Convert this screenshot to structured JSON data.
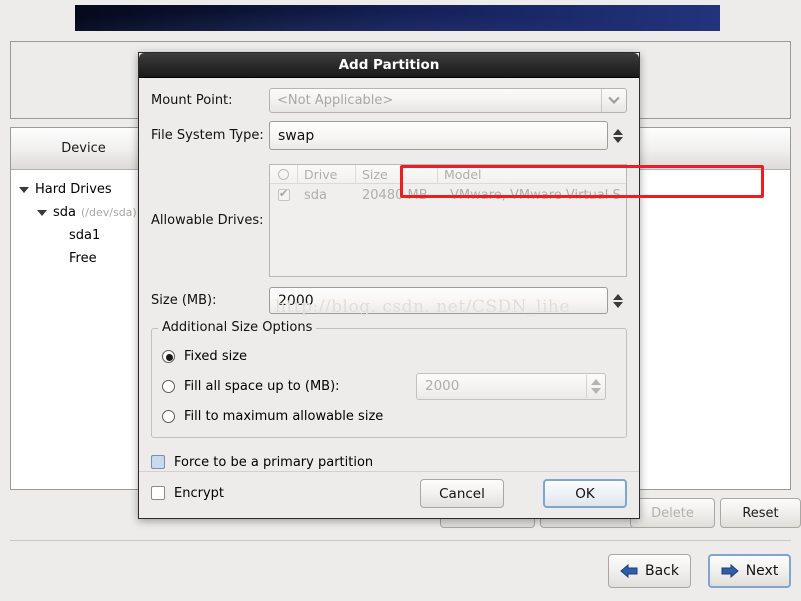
{
  "background_window": {
    "banner": {
      "name": "installer-banner"
    },
    "device_tree": {
      "columns": [
        "Device"
      ],
      "rows": [
        {
          "label": "Hard Drives",
          "sub": "",
          "indent": 0,
          "expander": true
        },
        {
          "label": "sda",
          "sub": "(/dev/sda)",
          "indent": 1,
          "expander": true
        },
        {
          "label": "sda1",
          "sub": "",
          "indent": 2,
          "expander": false
        },
        {
          "label": "Free",
          "sub": "",
          "indent": 2,
          "expander": false
        }
      ]
    },
    "action_buttons": [
      {
        "label": "",
        "disabled": false
      },
      {
        "label": "",
        "disabled": false
      },
      {
        "label": "Delete",
        "disabled": true
      },
      {
        "label": "Reset",
        "disabled": false
      }
    ],
    "nav_buttons": [
      {
        "label": "Back",
        "icon": "arrow-left-icon",
        "focused": false
      },
      {
        "label": "Next",
        "icon": "arrow-right-icon",
        "focused": true
      }
    ]
  },
  "dialog": {
    "title": "Add Partition",
    "mount_point": {
      "label": "Mount Point:",
      "value": "<Not Applicable>",
      "disabled": true,
      "icon": "chevron-down-icon"
    },
    "file_system_type": {
      "label": "File System Type:",
      "value": "swap",
      "highlighted": true,
      "icon": "spinner-updown-icon"
    },
    "allowable_drives": {
      "label": "Allowable Drives:",
      "columns": [
        "O",
        "Drive",
        "Size",
        "Model"
      ],
      "rows": [
        {
          "checked": true,
          "drive": "sda",
          "size": "20480 MB",
          "model": "VMware, VMware Virtual S"
        }
      ]
    },
    "size": {
      "label": "Size (MB):",
      "value": "2000"
    },
    "additional_size_options": {
      "title": "Additional Size Options",
      "options": [
        {
          "label": "Fixed size",
          "selected": true
        },
        {
          "label": "Fill all space up to (MB):",
          "selected": false,
          "field_value": "2000"
        },
        {
          "label": "Fill to maximum allowable size",
          "selected": false
        }
      ]
    },
    "checkboxes": [
      {
        "label": "Force to be a primary partition",
        "checked": false,
        "highlighted": true
      },
      {
        "label": "Encrypt",
        "checked": false,
        "highlighted": false
      }
    ],
    "buttons": [
      {
        "label": "Cancel",
        "primary": false
      },
      {
        "label": "OK",
        "primary": true
      }
    ]
  },
  "watermark": {
    "text": "http://blog. csdn. net/CSDN_lihe"
  },
  "colors": {
    "accent_red": "#ee1d24",
    "focus_blue": "#7da7d0",
    "arrow_blue": "#2f5fa8",
    "banner_blue": "#16215a",
    "window_bg": "#edeceb"
  }
}
